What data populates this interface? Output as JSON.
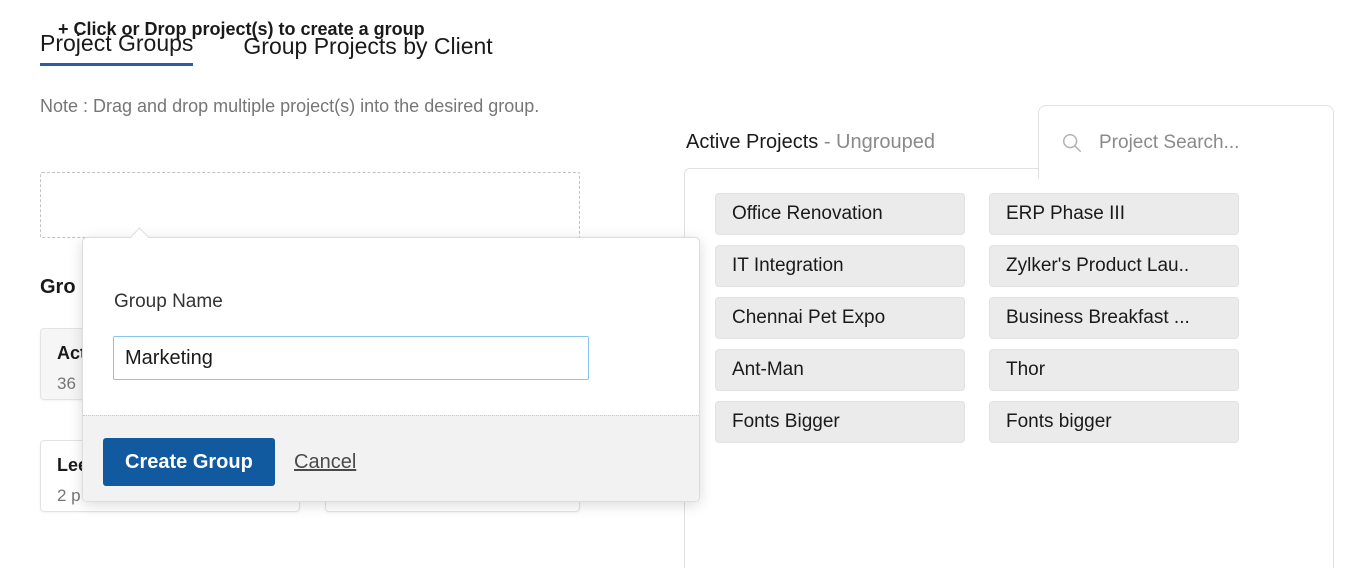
{
  "tabs": [
    {
      "label": "Project Groups",
      "active": true
    },
    {
      "label": "Group Projects by Client",
      "active": false
    }
  ],
  "note": "Note : Drag and drop multiple project(s) into the desired group.",
  "dropzone": {
    "label": "+ Click or Drop project(s) to create a group"
  },
  "groups_section": {
    "title": "Gro",
    "cards": [
      {
        "title": "Act",
        "subtitle": "36"
      },
      {
        "title": "Lee",
        "subtitle": "2 p"
      }
    ]
  },
  "right_panel": {
    "heading_main": "Active Projects",
    "heading_sub": " - Ungrouped",
    "search": {
      "placeholder": "Project Search...",
      "value": "",
      "icon": "search-icon"
    },
    "projects": [
      "Office Renovation",
      "ERP Phase III",
      "IT Integration",
      "Zylker's Product Lau..",
      "Chennai Pet Expo",
      "Business Breakfast ...",
      "Ant-Man",
      "Thor",
      "Fonts Bigger",
      "Fonts bigger"
    ]
  },
  "popup": {
    "field_label": "Group Name",
    "input_value": "Marketing",
    "input_placeholder": "",
    "create_label": "Create Group",
    "cancel_label": "Cancel"
  },
  "colors": {
    "accent_blue": "#115aa0",
    "tab_underline": "#2a5fa8",
    "input_focus": "#87c4ef",
    "tile_bg": "#ebebeb",
    "muted_text": "#767676"
  }
}
